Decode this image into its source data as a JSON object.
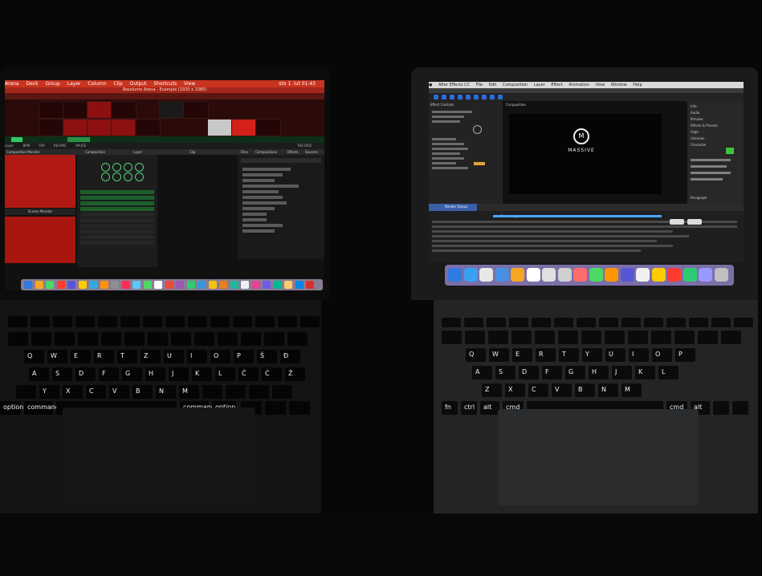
{
  "left_laptop": {
    "menubar": {
      "items": [
        "Arena",
        "Deck",
        "Group",
        "Layer",
        "Column",
        "Clip",
        "Output",
        "Shortcuts",
        "View"
      ],
      "clock": "sto 1. lut 01:43"
    },
    "window_title": "Resolume Arena - Example (1920 x 1080)",
    "column_headers": [
      "Column 1",
      "Column 2",
      "Column 3",
      "Column 4",
      "Column 5",
      "Column 6",
      "Column 7",
      "Column 8",
      "Column 9",
      "Column 10",
      "Column 11"
    ],
    "status_bar": [
      "Layer",
      "BPM",
      "TAP",
      "RESYNC",
      "PAUSE",
      "RECORD"
    ],
    "panels": [
      "Composition Monitor",
      "Composition",
      "Layer",
      "Clip",
      "Files",
      "Compositions",
      "Effects",
      "Sources"
    ],
    "screen_monitor_label": "Screen Monitor",
    "dock_colors": [
      "#2f7ae5",
      "#f5a623",
      "#4cd964",
      "#ff3b30",
      "#5856d6",
      "#ffcc00",
      "#34aadc",
      "#ff9500",
      "#8e8e93",
      "#ff2d55",
      "#5ac8fa",
      "#4cd964",
      "#ffffff",
      "#e74c3c",
      "#9b59b6",
      "#2ecc71",
      "#3498db",
      "#f1c40f",
      "#e67e22",
      "#1abc9c",
      "#ecf0f1",
      "#e84393",
      "#6c5ce7",
      "#00b894",
      "#fdcb6e",
      "#0984e3",
      "#d63031"
    ],
    "keyboard_labels": {
      "row_q": [
        "Q",
        "W",
        "E",
        "R",
        "T",
        "Z",
        "U",
        "I",
        "O",
        "P",
        "Š",
        "Đ"
      ],
      "row_a": [
        "A",
        "S",
        "D",
        "F",
        "G",
        "H",
        "J",
        "K",
        "L",
        "Č",
        "Ć",
        "Ž"
      ],
      "row_y": [
        "Y",
        "X",
        "C",
        "V",
        "B",
        "N",
        "M"
      ],
      "bottom": [
        "option",
        "command",
        "command",
        "option"
      ]
    }
  },
  "right_laptop": {
    "menubar": {
      "items": [
        "After Effects CC",
        "File",
        "Edit",
        "Composition",
        "Layer",
        "Effect",
        "Animation",
        "View",
        "Window",
        "Help"
      ]
    },
    "panels": [
      "Effect Controls",
      "Composition",
      "Layer",
      "Info",
      "Audio",
      "Preview",
      "Effects & Presets",
      "Align",
      "Libraries",
      "Character",
      "Paragraph"
    ],
    "logo": {
      "symbol": "M",
      "text": "MASSIVE"
    },
    "render_queue_tab": "Render Queue",
    "render_status": "Rendering",
    "dock_colors": [
      "#2f7ae5",
      "#3aa0f0",
      "#e8e8e8",
      "#4a90e2",
      "#f5a623",
      "#ffffff",
      "#e0e0e0",
      "#d0d0d0",
      "#ff6b6b",
      "#4cd964",
      "#ff9500",
      "#5856d6",
      "#f0f0f0",
      "#ffcc00",
      "#ff3b30",
      "#2ecc71",
      "#9999ff",
      "#c0c0c0"
    ],
    "keyboard_labels": {
      "row_q": [
        "Q",
        "W",
        "E",
        "R",
        "T",
        "Y",
        "U",
        "I",
        "O",
        "P"
      ],
      "row_a": [
        "A",
        "S",
        "D",
        "F",
        "G",
        "H",
        "J",
        "K",
        "L"
      ],
      "row_z": [
        "Z",
        "X",
        "C",
        "V",
        "B",
        "N",
        "M"
      ],
      "bottom": [
        "fn",
        "ctrl",
        "alt",
        "cmd",
        "cmd",
        "alt"
      ]
    }
  }
}
